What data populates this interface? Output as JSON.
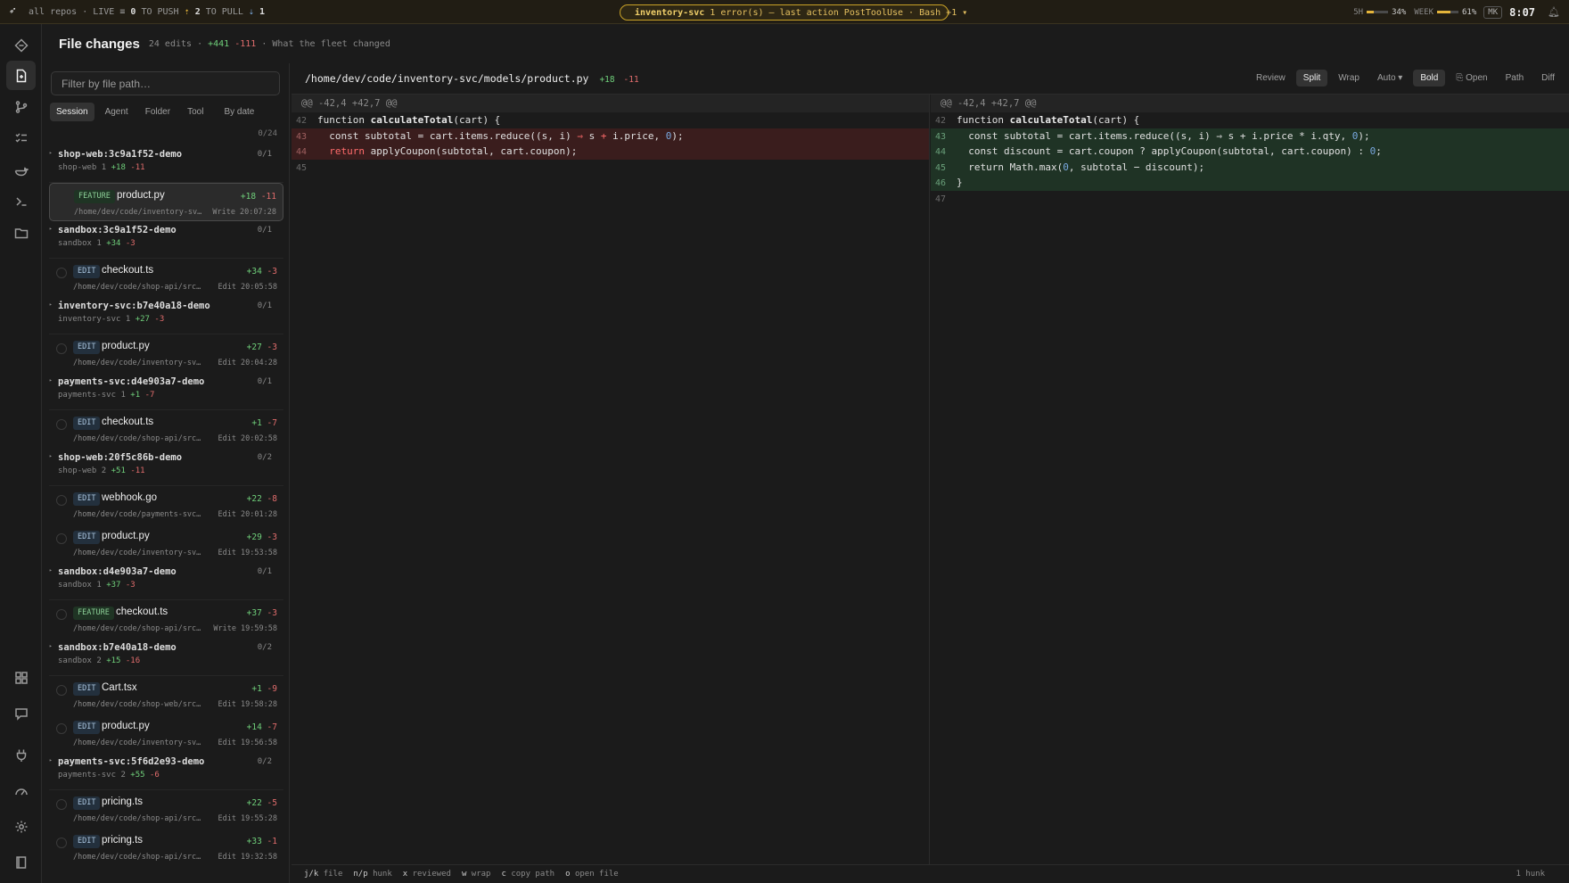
{
  "topbar": {
    "repos": "all repos",
    "live_label": "LIVE",
    "live_value": "0",
    "to_push_label": "TO PUSH",
    "to_push_value": "2",
    "to_pull_label": "TO PULL",
    "to_pull_value": "1",
    "alert": {
      "service": "inventory-svc",
      "message": "1 error(s) — last action PostToolUse · Bash +1 ▾"
    },
    "usage_5h_label": "5H",
    "usage_5h_value": "34%",
    "usage_5h_fraction": 0.34,
    "usage_week_label": "WEEK",
    "usage_week_value": "61%",
    "usage_week_fraction": 0.61,
    "user_initials": "MK",
    "clock": "8:07"
  },
  "header": {
    "title": "File changes",
    "edits": "24 edits",
    "additions": "+441",
    "deletions": "-111",
    "subtitle": "What the fleet changed"
  },
  "filter": {
    "placeholder": "Filter by file path…"
  },
  "group_tabs": [
    "Session",
    "Agent",
    "Folder",
    "Tool",
    "By date"
  ],
  "reviewed_count": "0/24",
  "sessions": [
    {
      "name": "shop-web:3c9a1f52-demo",
      "count": "0/1",
      "repo": "shop-web",
      "n": "1",
      "add": "+18",
      "del": "-11",
      "files": [
        {
          "badge": "FEATURE",
          "name": "product.py",
          "add": "+18",
          "del": "-11",
          "path": "/home/dev/code/inventory-sv…",
          "action": "Write 20:07:28",
          "selected": true
        }
      ]
    },
    {
      "name": "sandbox:3c9a1f52-demo",
      "count": "0/1",
      "repo": "sandbox",
      "n": "1",
      "add": "+34",
      "del": "-3",
      "files": [
        {
          "badge": "EDIT",
          "name": "checkout.ts",
          "add": "+34",
          "del": "-3",
          "path": "/home/dev/code/shop-api/src/…",
          "action": "Edit 20:05:58"
        }
      ]
    },
    {
      "name": "inventory-svc:b7e40a18-demo",
      "count": "0/1",
      "repo": "inventory-svc",
      "n": "1",
      "add": "+27",
      "del": "-3",
      "files": [
        {
          "badge": "EDIT",
          "name": "product.py",
          "add": "+27",
          "del": "-3",
          "path": "/home/dev/code/inventory-svc…",
          "action": "Edit 20:04:28"
        }
      ]
    },
    {
      "name": "payments-svc:d4e903a7-demo",
      "count": "0/1",
      "repo": "payments-svc",
      "n": "1",
      "add": "+1",
      "del": "-7",
      "files": [
        {
          "badge": "EDIT",
          "name": "checkout.ts",
          "add": "+1",
          "del": "-7",
          "path": "/home/dev/code/shop-api/src/…",
          "action": "Edit 20:02:58"
        }
      ]
    },
    {
      "name": "shop-web:20f5c86b-demo",
      "count": "0/2",
      "repo": "shop-web",
      "n": "2",
      "add": "+51",
      "del": "-11",
      "files": [
        {
          "badge": "EDIT",
          "name": "webhook.go",
          "add": "+22",
          "del": "-8",
          "path": "/home/dev/code/payments-svc/…",
          "action": "Edit 20:01:28"
        },
        {
          "badge": "EDIT",
          "name": "product.py",
          "add": "+29",
          "del": "-3",
          "path": "/home/dev/code/inventory-svc…",
          "action": "Edit 19:53:58"
        }
      ]
    },
    {
      "name": "sandbox:d4e903a7-demo",
      "count": "0/1",
      "repo": "sandbox",
      "n": "1",
      "add": "+37",
      "del": "-3",
      "files": [
        {
          "badge": "FEATURE",
          "name": "checkout.ts",
          "add": "+37",
          "del": "-3",
          "path": "/home/dev/code/shop-api/src…",
          "action": "Write 19:59:58"
        }
      ]
    },
    {
      "name": "sandbox:b7e40a18-demo",
      "count": "0/2",
      "repo": "sandbox",
      "n": "2",
      "add": "+15",
      "del": "-16",
      "files": [
        {
          "badge": "EDIT",
          "name": "Cart.tsx",
          "add": "+1",
          "del": "-9",
          "path": "/home/dev/code/shop-web/src/…",
          "action": "Edit 19:58:28"
        },
        {
          "badge": "EDIT",
          "name": "product.py",
          "add": "+14",
          "del": "-7",
          "path": "/home/dev/code/inventory-svc…",
          "action": "Edit 19:56:58"
        }
      ]
    },
    {
      "name": "payments-svc:5f6d2e93-demo",
      "count": "0/2",
      "repo": "payments-svc",
      "n": "2",
      "add": "+55",
      "del": "-6",
      "files": [
        {
          "badge": "EDIT",
          "name": "pricing.ts",
          "add": "+22",
          "del": "-5",
          "path": "/home/dev/code/shop-api/src/…",
          "action": "Edit 19:55:28"
        },
        {
          "badge": "EDIT",
          "name": "pricing.ts",
          "add": "+33",
          "del": "-1",
          "path": "/home/dev/code/shop-api/src/…",
          "action": "Edit 19:32:58"
        }
      ]
    }
  ],
  "diff": {
    "path": "/home/dev/code/inventory-svc/models/product.py",
    "add": "+18",
    "del": "-11",
    "toolbar": [
      "Review",
      "Split",
      "Wrap",
      "Auto ▾",
      "Bold",
      "⎘ Open",
      "Path",
      "Diff"
    ],
    "hunk_header": "@@ -42,4 +42,7 @@",
    "left_lines": [
      {
        "no": "42",
        "type": "ctx",
        "code": "function calculateTotal(cart) {"
      },
      {
        "no": "43",
        "type": "del",
        "code": "  const subtotal = cart.items.reduce((s, i) ⇒ s + i.price, 0);"
      },
      {
        "no": "44",
        "type": "del",
        "code": "  return applyCoupon(subtotal, cart.coupon);"
      },
      {
        "no": "45",
        "type": "ctx",
        "code": ""
      }
    ],
    "right_lines": [
      {
        "no": "42",
        "type": "ctx",
        "code": "function calculateTotal(cart) {"
      },
      {
        "no": "43",
        "type": "add",
        "code": "  const subtotal = cart.items.reduce((s, i) ⇒ s + i.price * i.qty, 0);"
      },
      {
        "no": "44",
        "type": "add",
        "code": "  const discount = cart.coupon ? applyCoupon(subtotal, cart.coupon) : 0;"
      },
      {
        "no": "45",
        "type": "add",
        "code": "  return Math.max(0, subtotal − discount);"
      },
      {
        "no": "46",
        "type": "add",
        "code": "}"
      },
      {
        "no": "47",
        "type": "ctx",
        "code": ""
      }
    ]
  },
  "statusbar": {
    "hints": [
      {
        "key": "j/k",
        "label": "file"
      },
      {
        "key": "n/p",
        "label": "hunk"
      },
      {
        "key": "x",
        "label": "reviewed"
      },
      {
        "key": "w",
        "label": "wrap"
      },
      {
        "key": "c",
        "label": "copy path"
      },
      {
        "key": "o",
        "label": "open file"
      }
    ],
    "hunks": "1 hunk"
  }
}
